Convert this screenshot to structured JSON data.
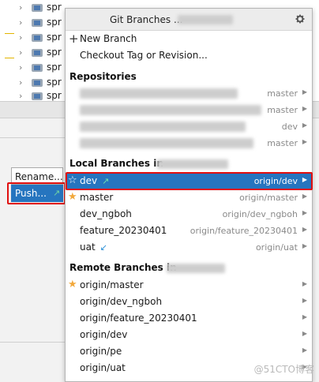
{
  "tree": {
    "items": [
      {
        "label": "spr"
      },
      {
        "label": "spr"
      },
      {
        "label": "spr"
      },
      {
        "label": "spr"
      },
      {
        "label": "spr"
      },
      {
        "label": "spr"
      },
      {
        "label": "spr"
      }
    ]
  },
  "context_menu": {
    "rename_label": "Rename...",
    "push_label": "Push...",
    "push_arrow": "↗"
  },
  "popup": {
    "title": "Git Branches",
    "title_suffix": "...",
    "gear_icon": "gear-icon",
    "actions": {
      "new_branch": "New Branch",
      "new_branch_prefix": "+",
      "checkout_tag": "Checkout Tag or Revision..."
    },
    "repositories": {
      "header": "Repositories",
      "items": [
        {
          "tracking": "master"
        },
        {
          "tracking": "master"
        },
        {
          "tracking": "dev"
        },
        {
          "tracking": "master"
        }
      ]
    },
    "local": {
      "header": "Local Branches in",
      "items": [
        {
          "name": "dev",
          "tracking": "origin/dev",
          "favorite": true,
          "incoming": "↗"
        },
        {
          "name": "master",
          "tracking": "origin/master",
          "favorite": true,
          "incoming": ""
        },
        {
          "name": "dev_ngboh",
          "tracking": "origin/dev_ngboh",
          "favorite": false,
          "incoming": ""
        },
        {
          "name": "feature_20230401",
          "tracking": "origin/feature_20230401",
          "favorite": false,
          "incoming": ""
        },
        {
          "name": "uat",
          "tracking": "origin/uat",
          "favorite": false,
          "incoming": "↙"
        }
      ]
    },
    "remote": {
      "header": "Remote Branches in",
      "items": [
        {
          "name": "origin/master",
          "favorite": true
        },
        {
          "name": "origin/dev_ngboh",
          "favorite": false
        },
        {
          "name": "origin/feature_20230401",
          "favorite": false
        },
        {
          "name": "origin/dev",
          "favorite": false
        },
        {
          "name": "origin/pe",
          "favorite": false
        },
        {
          "name": "origin/uat",
          "favorite": false
        }
      ]
    },
    "submenu_arrow": "▶"
  },
  "watermark": "@51CTO博客",
  "colors": {
    "selection": "#2675bf",
    "highlight_box": "#e01010",
    "star": "#f2a83b"
  }
}
